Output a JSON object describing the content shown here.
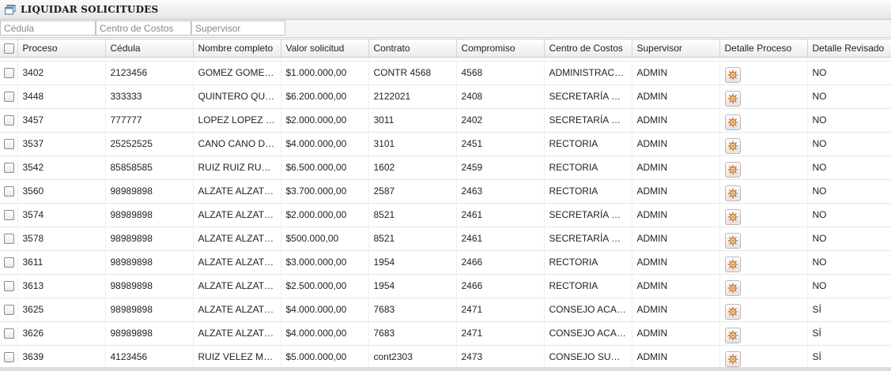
{
  "window": {
    "title": "LIQUIDAR SOLICITUDES",
    "icon": "window-icon"
  },
  "filters": {
    "cedula_placeholder": "Cédula",
    "centro_placeholder": "Centro de Costos",
    "supervisor_placeholder": "Supervisor",
    "cedula_value": "",
    "centro_value": "",
    "supervisor_value": ""
  },
  "table": {
    "columns": [
      "Proceso",
      "Cédula",
      "Nombre completo",
      "Valor solicitud",
      "Contrato",
      "Compromiso",
      "Centro de Costos",
      "Supervisor",
      "Detalle Proceso",
      "Detalle Revisado"
    ],
    "rows": [
      {
        "proceso": "3402",
        "cedula": "2123456",
        "nombre": "GOMEZ GOMEZ GOMEZ",
        "valor": "$1.000.000,00",
        "contrato": "CONTR 4568",
        "compromiso": "4568",
        "centro": "ADMINISTRACION",
        "supervisor": "ADMIN",
        "revisado": "NO"
      },
      {
        "proceso": "3448",
        "cedula": "333333",
        "nombre": "QUINTERO QUINTERO",
        "valor": "$6.200.000,00",
        "contrato": "2122021",
        "compromiso": "2408",
        "centro": "SECRETARÍA GENERAL",
        "supervisor": "ADMIN",
        "revisado": "NO"
      },
      {
        "proceso": "3457",
        "cedula": "777777",
        "nombre": "LOPEZ LOPEZ FERNANDO",
        "valor": "$2.000.000,00",
        "contrato": "3011",
        "compromiso": "2402",
        "centro": "SECRETARÍA GENERAL",
        "supervisor": "ADMIN",
        "revisado": "NO"
      },
      {
        "proceso": "3537",
        "cedula": "25252525",
        "nombre": "CANO CANO DIANA",
        "valor": "$4.000.000,00",
        "contrato": "3101",
        "compromiso": "2451",
        "centro": "RECTORIA",
        "supervisor": "ADMIN",
        "revisado": "NO"
      },
      {
        "proceso": "3542",
        "cedula": "85858585",
        "nombre": "RUIZ RUIZ RUBIELA",
        "valor": "$6.500.000,00",
        "contrato": "1602",
        "compromiso": "2459",
        "centro": "RECTORIA",
        "supervisor": "ADMIN",
        "revisado": "NO"
      },
      {
        "proceso": "3560",
        "cedula": "98989898",
        "nombre": "ALZATE ALZATE ALZATE",
        "valor": "$3.700.000,00",
        "contrato": "2587",
        "compromiso": "2463",
        "centro": "RECTORIA",
        "supervisor": "ADMIN",
        "revisado": "NO"
      },
      {
        "proceso": "3574",
        "cedula": "98989898",
        "nombre": "ALZATE ALZATE ALZATE",
        "valor": "$2.000.000,00",
        "contrato": "8521",
        "compromiso": "2461",
        "centro": "SECRETARÍA GENERAL",
        "supervisor": "ADMIN",
        "revisado": "NO"
      },
      {
        "proceso": "3578",
        "cedula": "98989898",
        "nombre": "ALZATE ALZATE ALZATE",
        "valor": "$500.000,00",
        "contrato": "8521",
        "compromiso": "2461",
        "centro": "SECRETARÍA GENERAL",
        "supervisor": "ADMIN",
        "revisado": "NO"
      },
      {
        "proceso": "3611",
        "cedula": "98989898",
        "nombre": "ALZATE ALZATE ALZATE",
        "valor": "$3.000.000,00",
        "contrato": "1954",
        "compromiso": "2466",
        "centro": "RECTORIA",
        "supervisor": "ADMIN",
        "revisado": "NO"
      },
      {
        "proceso": "3613",
        "cedula": "98989898",
        "nombre": "ALZATE ALZATE ALZATE",
        "valor": "$2.500.000,00",
        "contrato": "1954",
        "compromiso": "2466",
        "centro": "RECTORIA",
        "supervisor": "ADMIN",
        "revisado": "NO"
      },
      {
        "proceso": "3625",
        "cedula": "98989898",
        "nombre": "ALZATE ALZATE ALZATE",
        "valor": "$4.000.000,00",
        "contrato": "7683",
        "compromiso": "2471",
        "centro": "CONSEJO ACADEMICO",
        "supervisor": "ADMIN",
        "revisado": "SÍ"
      },
      {
        "proceso": "3626",
        "cedula": "98989898",
        "nombre": "ALZATE ALZATE ALZATE",
        "valor": "$4.000.000,00",
        "contrato": "7683",
        "compromiso": "2471",
        "centro": "CONSEJO ACADEMICO",
        "supervisor": "ADMIN",
        "revisado": "SÍ"
      },
      {
        "proceso": "3639",
        "cedula": "4123456",
        "nombre": "RUIZ VELEZ MARIA",
        "valor": "$5.000.000,00",
        "contrato": "cont2303",
        "compromiso": "2473",
        "centro": "CONSEJO SUPERIOR",
        "supervisor": "ADMIN",
        "revisado": "SÍ"
      }
    ]
  },
  "colors": {
    "header_gradient_top": "#ffffff",
    "header_gradient_bottom": "#ececec",
    "row_border": "#e6e6e6",
    "gear_orange": "#d9742a"
  }
}
